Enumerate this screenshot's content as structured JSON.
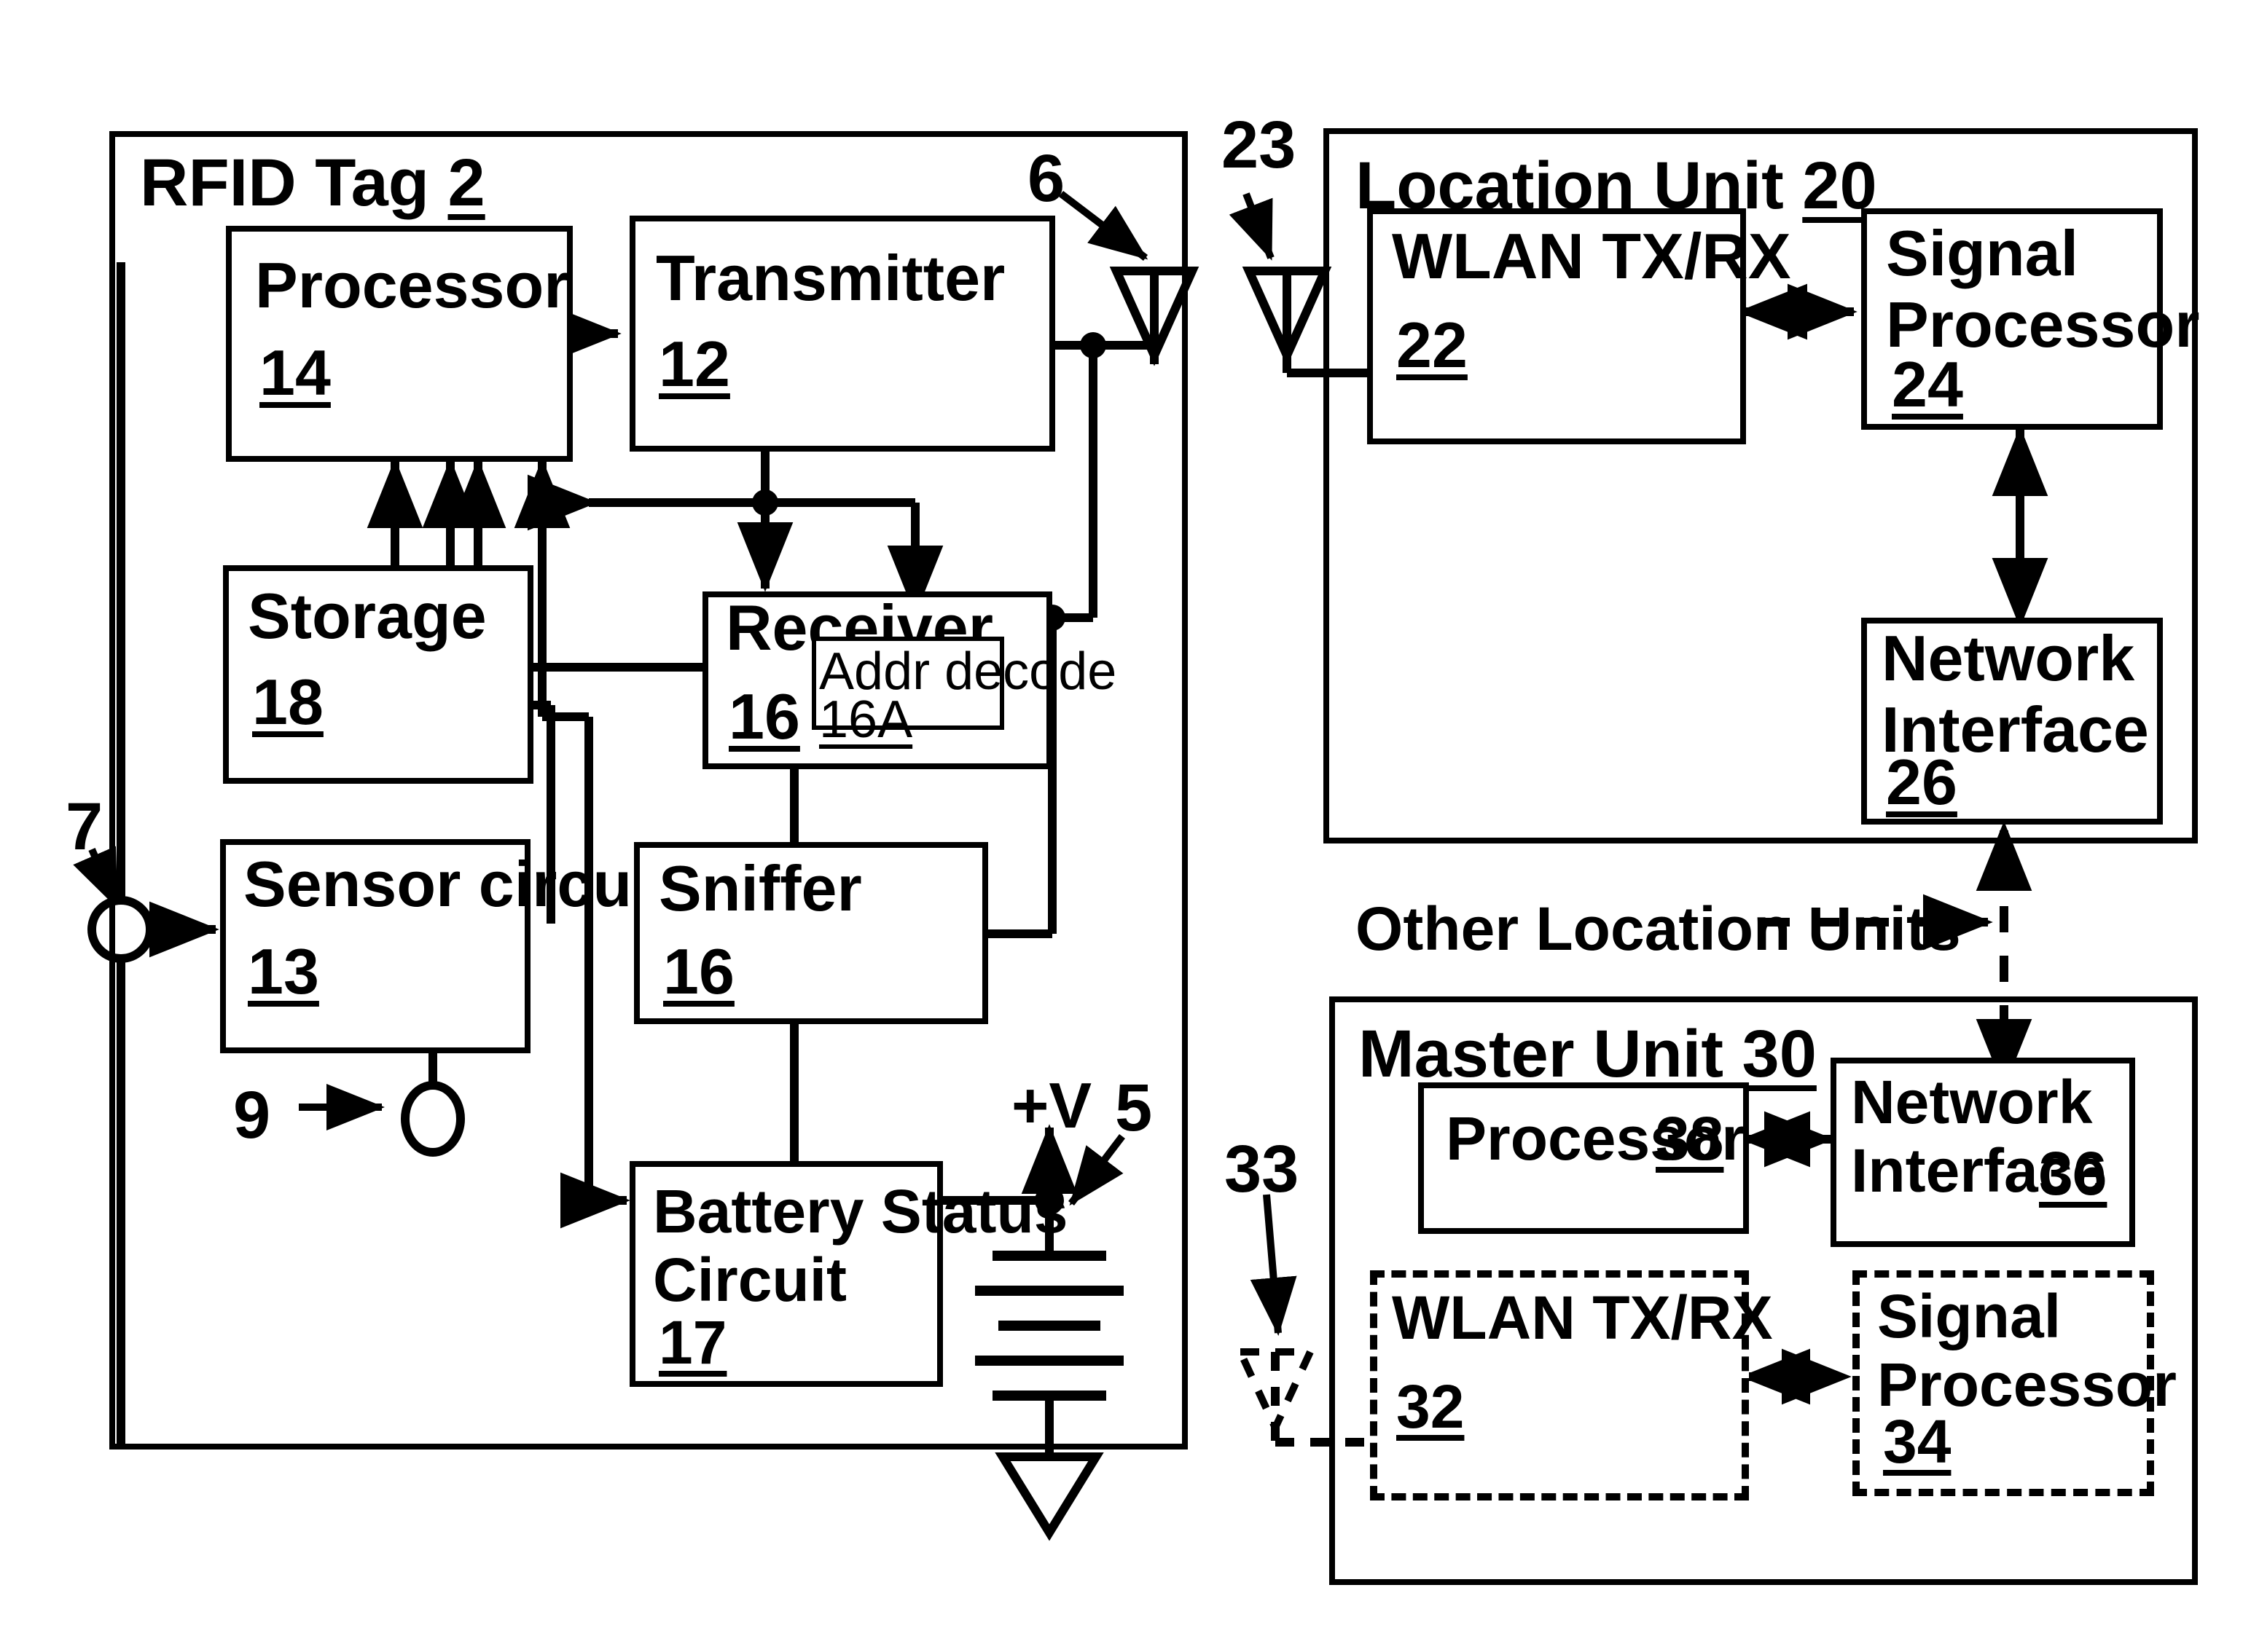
{
  "figure": {
    "type": "patent-block-diagram",
    "background": "#ffffff",
    "line_color": "#000000"
  },
  "rfid_tag": {
    "title_text": "RFID Tag",
    "title_num": "2",
    "callouts": {
      "antenna_6": "6",
      "sensor_input_7": "7",
      "sensor_output_9": "9",
      "battery_5": "5"
    },
    "supply_label": "+V",
    "blocks": [
      {
        "label": "Processor",
        "num": "14"
      },
      {
        "label": "Transmitter",
        "num": "12"
      },
      {
        "label": "Storage",
        "num": "18"
      },
      {
        "label": "Receiver",
        "num": "16"
      },
      {
        "label": "Addr decode",
        "num": "16A"
      },
      {
        "label": "Sensor circuit",
        "num": "13"
      },
      {
        "label": "Sniffer",
        "num": "16"
      },
      {
        "label": "Battery Status\nCircuit",
        "num": "17"
      }
    ]
  },
  "location_unit": {
    "title_text": "Location Unit",
    "title_num": "20",
    "callouts": {
      "antenna_23": "23"
    },
    "blocks": [
      {
        "label": "WLAN TX/RX",
        "num": "22"
      },
      {
        "label": "Signal\nProcessor",
        "num": "24"
      },
      {
        "label": "Network\nInterface",
        "num": "26"
      }
    ]
  },
  "other_location_units": {
    "label": "Other Location Units"
  },
  "master_unit": {
    "title_text": "Master Unit",
    "title_num": "30",
    "callouts": {
      "antenna_33": "33"
    },
    "blocks": [
      {
        "label": "Processor",
        "num": "38",
        "style": "solid",
        "inline_num": true
      },
      {
        "label": "Network\nInterface",
        "num": "36",
        "style": "solid",
        "inline_num": true
      },
      {
        "label": "WLAN TX/RX",
        "num": "32",
        "style": "dashed",
        "inline_num": false
      },
      {
        "label": "Signal\nProcessor",
        "num": "34",
        "style": "dashed",
        "inline_num": false
      }
    ]
  }
}
